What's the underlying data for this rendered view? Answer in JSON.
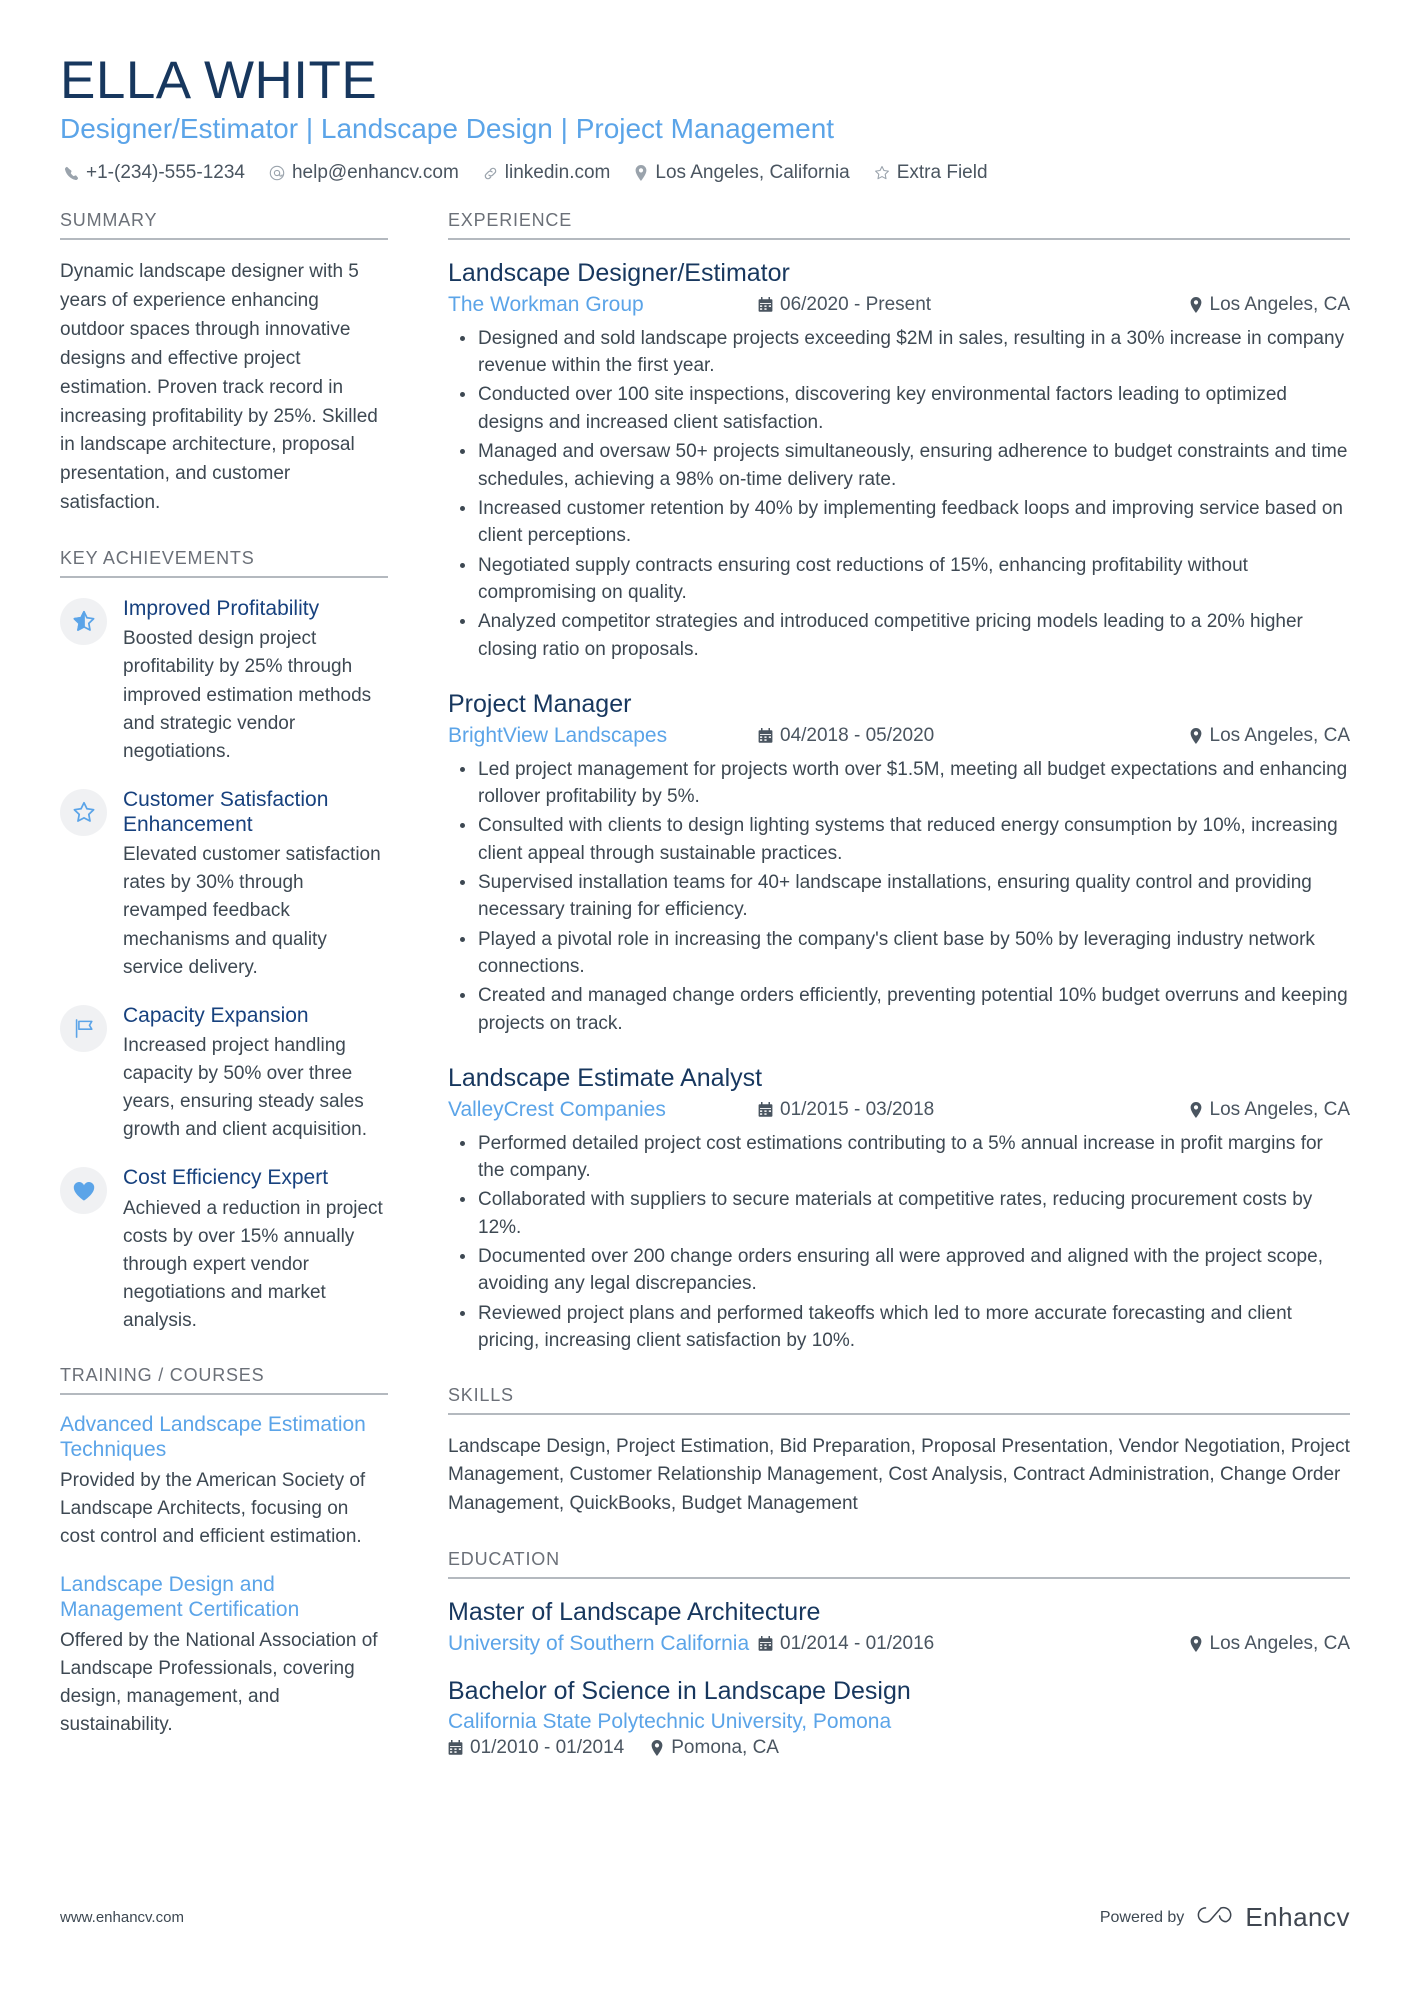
{
  "header": {
    "name": "ELLA WHITE",
    "headline": "Designer/Estimator | Landscape Design | Project Management",
    "contacts": [
      {
        "icon": "phone-icon",
        "text": "+1-(234)-555-1234"
      },
      {
        "icon": "email-icon",
        "text": "help@enhancv.com"
      },
      {
        "icon": "link-icon",
        "text": "linkedin.com"
      },
      {
        "icon": "location-pin-icon",
        "text": "Los Angeles, California"
      },
      {
        "icon": "star-icon",
        "text": "Extra Field"
      }
    ]
  },
  "summary": {
    "title": "SUMMARY",
    "text": "Dynamic landscape designer with 5 years of experience enhancing outdoor spaces through innovative designs and effective project estimation. Proven track record in increasing profitability by 25%. Skilled in landscape architecture, proposal presentation, and customer satisfaction."
  },
  "key_achievements": {
    "title": "KEY ACHIEVEMENTS",
    "items": [
      {
        "icon": "star-half-icon",
        "title": "Improved Profitability",
        "description": "Boosted design project profitability by 25% through improved estimation methods and strategic vendor negotiations."
      },
      {
        "icon": "star-outline-icon",
        "title": "Customer Satisfaction Enhancement",
        "description": "Elevated customer satisfaction rates by 30% through revamped feedback mechanisms and quality service delivery."
      },
      {
        "icon": "flag-icon",
        "title": "Capacity Expansion",
        "description": "Increased project handling capacity by 50% over three years, ensuring steady sales growth and client acquisition."
      },
      {
        "icon": "heart-icon",
        "title": "Cost Efficiency Expert",
        "description": "Achieved a reduction in project costs by over 15% annually through expert vendor negotiations and market analysis."
      }
    ]
  },
  "training": {
    "title": "TRAINING / COURSES",
    "items": [
      {
        "title": "Advanced Landscape Estimation Techniques",
        "description": "Provided by the American Society of Landscape Architects, focusing on cost control and efficient estimation."
      },
      {
        "title": "Landscape Design and Management Certification",
        "description": "Offered by the National Association of Landscape Professionals, covering design, management, and sustainability."
      }
    ]
  },
  "experience": {
    "title": "EXPERIENCE",
    "jobs": [
      {
        "title": "Landscape Designer/Estimator",
        "company": "The Workman Group",
        "dates": "06/2020 - Present",
        "location": "Los Angeles, CA",
        "bullets": [
          "Designed and sold landscape projects exceeding $2M in sales, resulting in a 30% increase in company revenue within the first year.",
          "Conducted over 100 site inspections, discovering key environmental factors leading to optimized designs and increased client satisfaction.",
          "Managed and oversaw 50+ projects simultaneously, ensuring adherence to budget constraints and time schedules, achieving a 98% on-time delivery rate.",
          "Increased customer retention by 40% by implementing feedback loops and improving service based on client perceptions.",
          "Negotiated supply contracts ensuring cost reductions of 15%, enhancing profitability without compromising on quality.",
          "Analyzed competitor strategies and introduced competitive pricing models leading to a 20% higher closing ratio on proposals."
        ]
      },
      {
        "title": "Project Manager",
        "company": "BrightView Landscapes",
        "dates": "04/2018 - 05/2020",
        "location": "Los Angeles, CA",
        "bullets": [
          "Led project management for projects worth over $1.5M, meeting all budget expectations and enhancing rollover profitability by 5%.",
          "Consulted with clients to design lighting systems that reduced energy consumption by 10%, increasing client appeal through sustainable practices.",
          "Supervised installation teams for 40+ landscape installations, ensuring quality control and providing necessary training for efficiency.",
          "Played a pivotal role in increasing the company's client base by 50% by leveraging industry network connections.",
          "Created and managed change orders efficiently, preventing potential 10% budget overruns and keeping projects on track."
        ]
      },
      {
        "title": "Landscape Estimate Analyst",
        "company": "ValleyCrest Companies",
        "dates": "01/2015 - 03/2018",
        "location": "Los Angeles, CA",
        "bullets": [
          "Performed detailed project cost estimations contributing to a 5% annual increase in profit margins for the company.",
          "Collaborated with suppliers to secure materials at competitive rates, reducing procurement costs by 12%.",
          "Documented over 200 change orders ensuring all were approved and aligned with the project scope, avoiding any legal discrepancies.",
          "Reviewed project plans and performed takeoffs which led to more accurate forecasting and client pricing, increasing client satisfaction by 10%."
        ]
      }
    ]
  },
  "skills": {
    "title": "SKILLS",
    "text": "Landscape Design, Project Estimation, Bid Preparation, Proposal Presentation, Vendor Negotiation, Project Management, Customer Relationship Management, Cost Analysis, Contract Administration, Change Order Management, QuickBooks, Budget Management"
  },
  "education": {
    "title": "EDUCATION",
    "items": [
      {
        "degree": "Master of Landscape Architecture",
        "school": "University of Southern California",
        "dates": "01/2014 - 01/2016",
        "location": "Los Angeles, CA",
        "layout": "inline"
      },
      {
        "degree": "Bachelor of Science in Landscape Design",
        "school": "California State Polytechnic University, Pomona",
        "dates": "01/2010 - 01/2014",
        "location": "Pomona, CA",
        "layout": "stacked"
      }
    ]
  },
  "footer": {
    "website": "www.enhancv.com",
    "powered_by": "Powered by",
    "brand": "Enhancv"
  },
  "colors": {
    "name_navy": "#17375e",
    "accent_blue": "#5ba4e8",
    "body_gray": "#3d4852",
    "rule_gray": "#b4b9bf"
  }
}
